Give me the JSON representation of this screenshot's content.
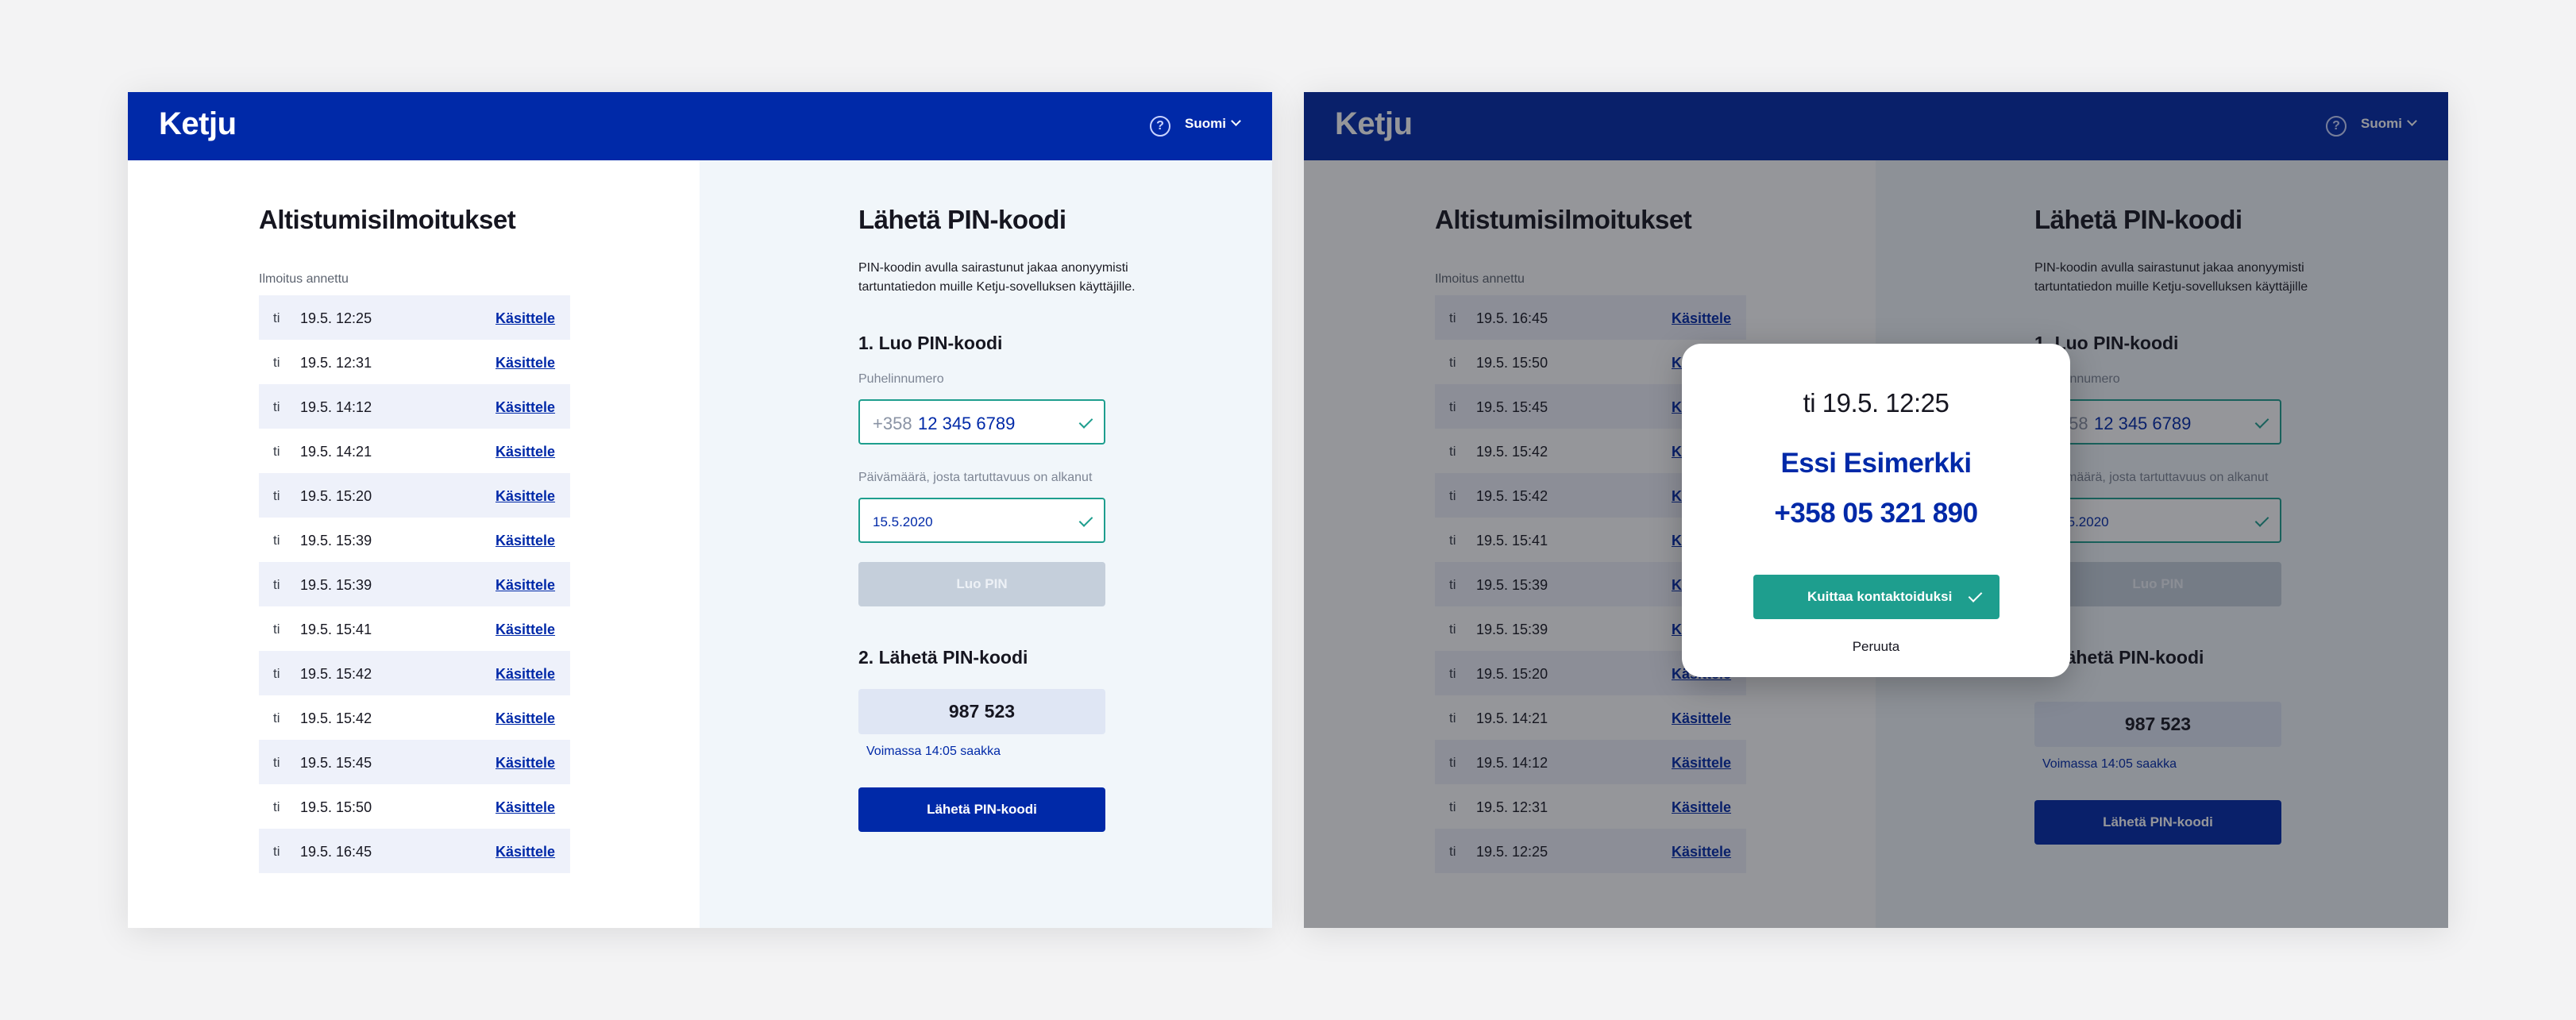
{
  "brand": "Ketju",
  "colors": {
    "primary": "#0029a8",
    "accent": "#1e9e8e",
    "page_background": "#f3f3f4"
  },
  "header": {
    "help_icon": "question-circle-icon",
    "help_glyph": "?",
    "language": "Suomi"
  },
  "notifications": {
    "title": "Altistumisilmoitukset",
    "list_label": "Ilmoitus annettu",
    "action_label": "Käsittele"
  },
  "left_screen": {
    "rows": [
      {
        "day": "ti",
        "time": "19.5. 12:25"
      },
      {
        "day": "ti",
        "time": "19.5. 12:31"
      },
      {
        "day": "ti",
        "time": "19.5. 14:12"
      },
      {
        "day": "ti",
        "time": "19.5. 14:21"
      },
      {
        "day": "ti",
        "time": "19.5. 15:20"
      },
      {
        "day": "ti",
        "time": "19.5. 15:39"
      },
      {
        "day": "ti",
        "time": "19.5. 15:39"
      },
      {
        "day": "ti",
        "time": "19.5. 15:41"
      },
      {
        "day": "ti",
        "time": "19.5. 15:42"
      },
      {
        "day": "ti",
        "time": "19.5. 15:42"
      },
      {
        "day": "ti",
        "time": "19.5. 15:45"
      },
      {
        "day": "ti",
        "time": "19.5. 15:50"
      },
      {
        "day": "ti",
        "time": "19.5. 16:45"
      }
    ]
  },
  "right_screen": {
    "rows": [
      {
        "day": "ti",
        "time": "19.5. 16:45"
      },
      {
        "day": "ti",
        "time": "19.5. 15:50"
      },
      {
        "day": "ti",
        "time": "19.5. 15:45"
      },
      {
        "day": "ti",
        "time": "19.5. 15:42"
      },
      {
        "day": "ti",
        "time": "19.5. 15:42"
      },
      {
        "day": "ti",
        "time": "19.5. 15:41"
      },
      {
        "day": "ti",
        "time": "19.5. 15:39"
      },
      {
        "day": "ti",
        "time": "19.5. 15:39"
      },
      {
        "day": "ti",
        "time": "19.5. 15:20"
      },
      {
        "day": "ti",
        "time": "19.5. 14:21"
      },
      {
        "day": "ti",
        "time": "19.5. 14:12"
      },
      {
        "day": "ti",
        "time": "19.5. 12:31"
      },
      {
        "day": "ti",
        "time": "19.5. 12:25"
      }
    ]
  },
  "pin": {
    "title": "Lähetä PIN-koodi",
    "description": "PIN-koodin avulla sairastunut jakaa anonyymisti tartuntatiedon muille Ketju-sovelluksen käyttäjille.",
    "description_alt": "PIN-koodin avulla sairastunut jakaa anonyymisti tartuntatiedon muille Ketju-sovelluksen käyttäjille",
    "step1_title": "1. Luo PIN-koodi",
    "phone_label": "Puhelinnumero",
    "phone_prefix": "+358",
    "phone_value": "12 345 6789",
    "date_label": "Päivämäärä, josta tartuttavuus on alkanut",
    "date_value": "15.5.2020",
    "create_button": "Luo PIN",
    "step2_title": "2. Lähetä PIN-koodi",
    "pin_code": "987 523",
    "valid_until": "Voimassa 14:05 saakka",
    "send_button": "Lähetä PIN-koodi"
  },
  "modal": {
    "time": "ti 19.5. 12:25",
    "name": "Essi Esimerkki",
    "phone": "+358 05 321 890",
    "confirm_button": "Kuittaa kontaktoiduksi",
    "cancel": "Peruuta"
  }
}
